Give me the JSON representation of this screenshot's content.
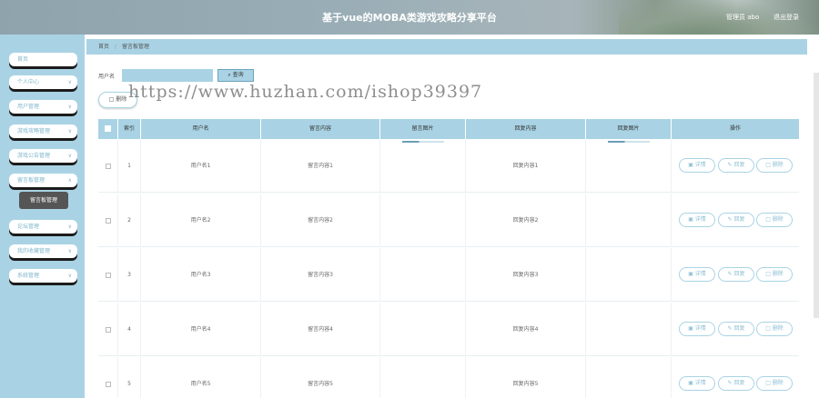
{
  "header": {
    "title": "基于vue的MOBA类游戏攻略分享平台",
    "user": "管理员 abo",
    "logout": "退出登录"
  },
  "sidebar": {
    "items": [
      {
        "label": "首页"
      },
      {
        "label": "个人中心"
      },
      {
        "label": "用户管理"
      },
      {
        "label": "游戏攻略管理"
      },
      {
        "label": "游戏公告管理"
      },
      {
        "label": "留言板管理"
      },
      {
        "label": "论坛管理"
      },
      {
        "label": "我的收藏管理"
      },
      {
        "label": "系统管理"
      }
    ],
    "submenu": "留言板管理"
  },
  "breadcrumb": {
    "home": "首页",
    "current": "留言板管理"
  },
  "watermark": "https://www.huzhan.com/ishop39397",
  "search": {
    "label": "用户名",
    "value": "",
    "button": "查询"
  },
  "toolbar": {
    "delete": "删除"
  },
  "table": {
    "headers": [
      "",
      "索引",
      "用户名",
      "留言内容",
      "留言图片",
      "回复内容",
      "回复图片",
      "操作"
    ],
    "rows": [
      {
        "index": "1",
        "username": "用户名1",
        "message": "留言内容1",
        "reply": "回复内容1"
      },
      {
        "index": "2",
        "username": "用户名2",
        "message": "留言内容2",
        "reply": "回复内容2"
      },
      {
        "index": "3",
        "username": "用户名3",
        "message": "留言内容3",
        "reply": "回复内容3"
      },
      {
        "index": "4",
        "username": "用户名4",
        "message": "留言内容4",
        "reply": "回复内容4"
      },
      {
        "index": "5",
        "username": "用户名5",
        "message": "留言内容5",
        "reply": "回复内容5"
      }
    ],
    "actions": {
      "detail": "详情",
      "reply": "回复",
      "delete": "删除"
    }
  },
  "colors": {
    "accent": "#a9d3e4",
    "header": "#9aaeb7"
  }
}
